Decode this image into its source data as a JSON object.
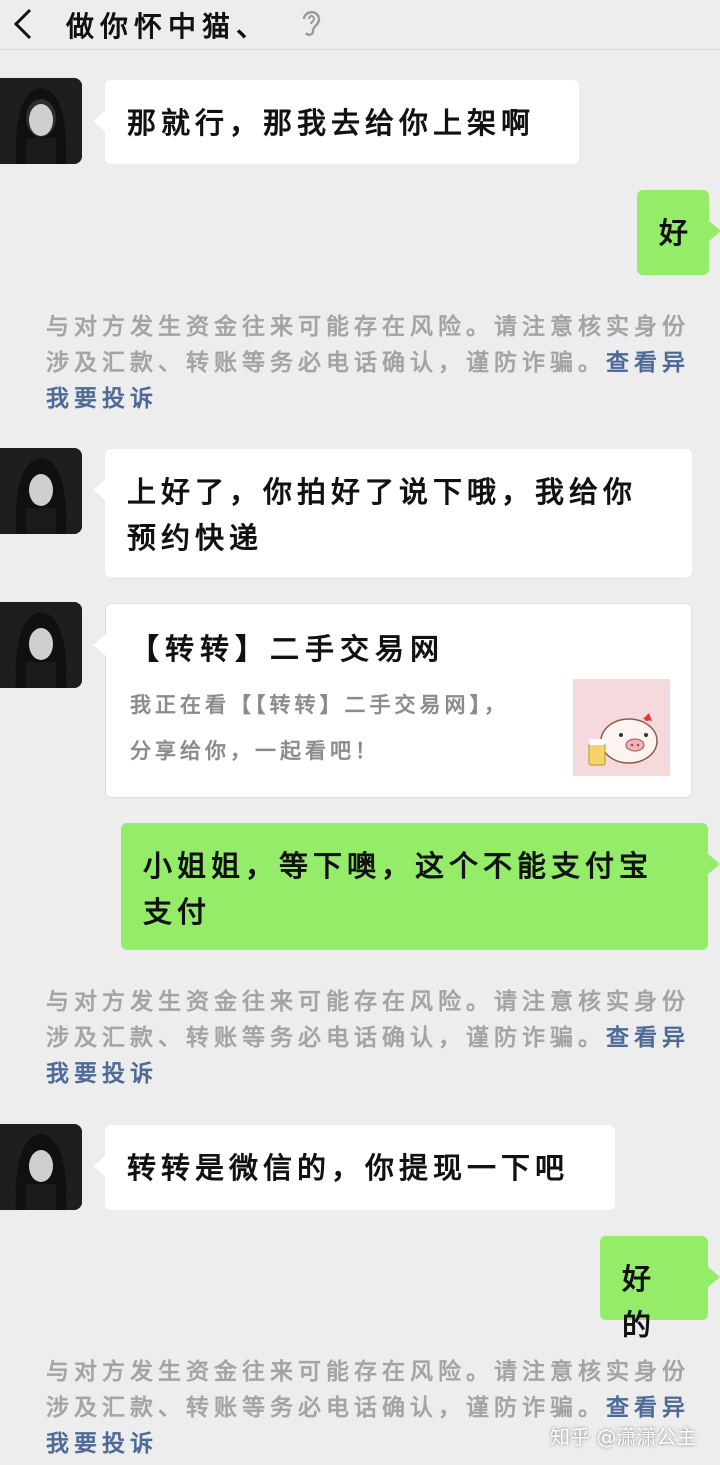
{
  "header": {
    "title": "做你怀中猫、",
    "back_icon": "chevron-left-icon",
    "voice_icon": "ear-icon"
  },
  "messages": [
    {
      "side": "left",
      "text": "那就行，那我去给你上架啊"
    },
    {
      "side": "right",
      "text": "好"
    },
    {
      "side": "left",
      "lines": [
        "上好了，你拍好了说下哦，我给你",
        "预约快递"
      ]
    },
    {
      "side": "left",
      "type": "share-card",
      "title": "【转转】二手交易网",
      "desc_lines": [
        "我正在看【【转转】二手交易网】，",
        "分享给你，一起看吧！"
      ],
      "thumb_icon": "pig-beer-icon"
    },
    {
      "side": "right",
      "lines": [
        "小姐姐，等下噢，这个不能支付宝",
        "支付"
      ]
    },
    {
      "side": "left",
      "text": "转转是微信的，你提现一下吧"
    },
    {
      "side": "right",
      "text": "好的"
    }
  ],
  "notice": {
    "line1": "与对方发生资金往来可能存在风险。请注意核实身份",
    "line2_prefix": "涉及汇款、转账等务必电话确认，谨防诈骗。",
    "view_link": "查看异",
    "report_link": "我要投诉"
  },
  "watermark": "知乎 @潇潇公主",
  "colors": {
    "background": "#ededed",
    "bubble_self": "#95ec69",
    "bubble_other": "#ffffff",
    "notice_text": "#a4a4a4",
    "link": "#4e6a97"
  }
}
